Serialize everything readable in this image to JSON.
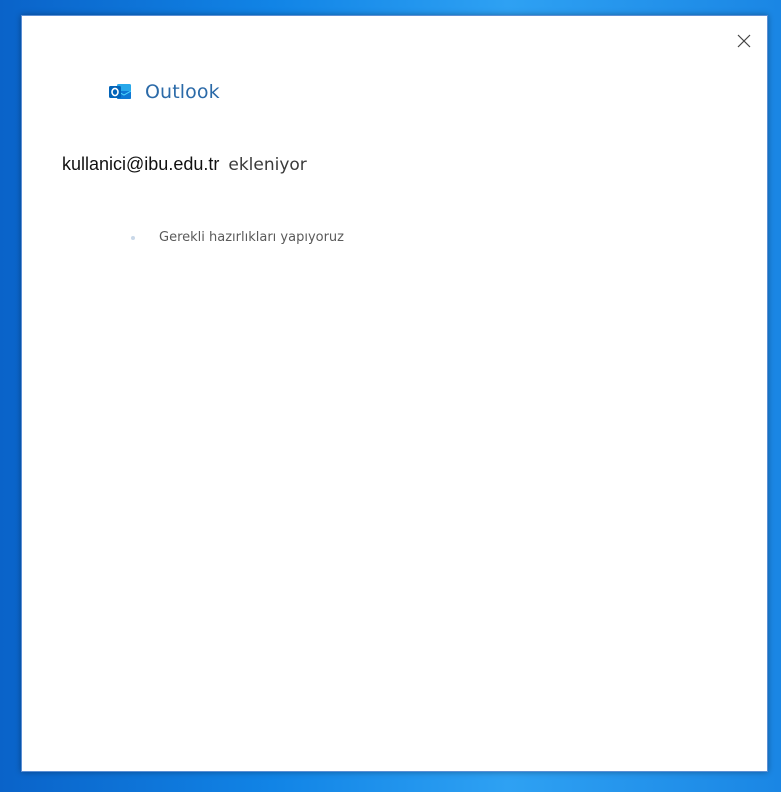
{
  "dialog": {
    "brand": {
      "name": "Outlook",
      "icon": "outlook-logo-icon",
      "color": "#2b6aa8"
    },
    "close_icon": "close-icon",
    "account": {
      "email": "kullanici@ibu.edu.tr",
      "status": "ekleniyor"
    },
    "progress": {
      "message": "Gerekli hazırlıkları yapıyoruz"
    }
  }
}
